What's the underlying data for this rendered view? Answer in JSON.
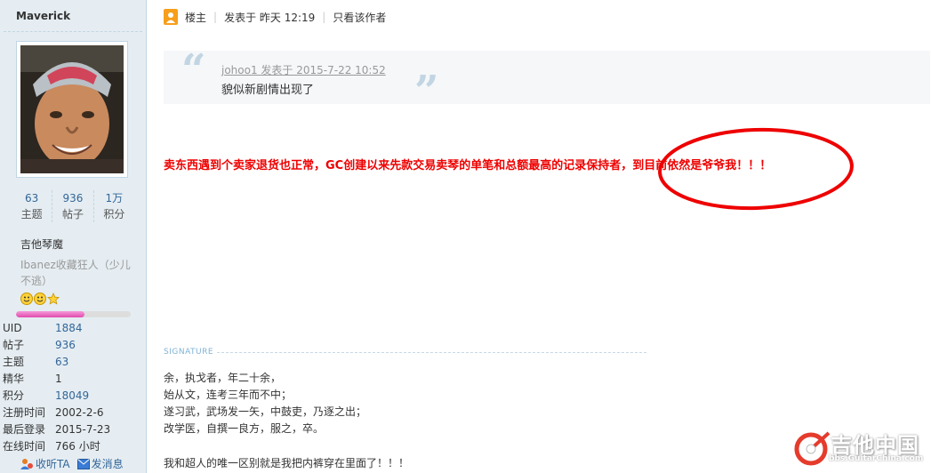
{
  "user": {
    "name": "Maverick",
    "stats": [
      {
        "num": "63",
        "label": "主题"
      },
      {
        "num": "936",
        "label": "帖子"
      },
      {
        "num": "1万",
        "label": "积分"
      }
    ],
    "group": "吉他琴魔",
    "title": "Ibanez收藏狂人（少儿不逃）",
    "progress": 0.6,
    "info": [
      {
        "k": "UID",
        "v": "1884",
        "link": true
      },
      {
        "k": "帖子",
        "v": "936",
        "link": true
      },
      {
        "k": "主题",
        "v": "63",
        "link": true
      },
      {
        "k": "精华",
        "v": "1",
        "link": false
      },
      {
        "k": "积分",
        "v": "18049",
        "link": true
      },
      {
        "k": "注册时间",
        "v": "2002-2-6",
        "link": false
      },
      {
        "k": "最后登录",
        "v": "2015-7-23",
        "link": false
      },
      {
        "k": "在线时间",
        "v": "766 小时",
        "link": false
      }
    ],
    "actions": {
      "follow": "收听TA",
      "message": "发消息"
    }
  },
  "post": {
    "owner_label": "楼主",
    "posted": "发表于 昨天 12:19",
    "only_author": "只看该作者",
    "quote": {
      "author": "johoo1 发表于 2015-7-22 10:52",
      "text": "貌似新剧情出现了"
    },
    "body": "卖东西遇到个卖家退货也正常，GC创建以来先款交易卖琴的单笔和总额最高的记录保持者，到目前依然是爷爷我！！！",
    "signature_label": "SIGNATURE",
    "signature": [
      "余，执戈者，年二十余，",
      "始从文，连考三年而不中；",
      "遂习武，武场发一矢，中鼓吏，乃逐之出；",
      "改学医，自撰一良方，服之，卒。"
    ],
    "signature_footer": "我和超人的唯一区别就是我把内裤穿在里面了！！！"
  },
  "watermark": {
    "site": "吉他中国",
    "url": "bbs.GuitarChina.com"
  },
  "colors": {
    "link": "#336699",
    "highlight": "#ee0000",
    "sidebar_bg": "#e5edf2"
  }
}
